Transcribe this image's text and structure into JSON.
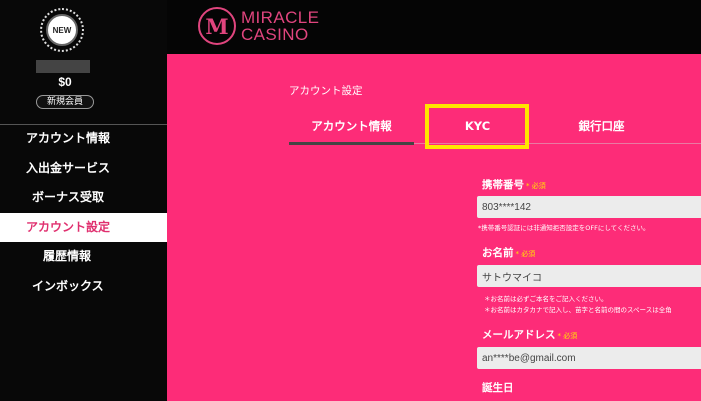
{
  "brand": {
    "line1": "MIRACLE",
    "line2": "CASINO",
    "emblem": "M"
  },
  "user": {
    "badge_label": "NEW",
    "balance": "$0",
    "member_tier": "新規会員"
  },
  "sidebar": {
    "items": [
      {
        "label": "アカウント情報"
      },
      {
        "label": "入出金サービス"
      },
      {
        "label": "ボーナス受取"
      },
      {
        "label": "アカウント設定"
      },
      {
        "label": "履歴情報"
      },
      {
        "label": "インボックス"
      }
    ],
    "active_index": 3
  },
  "main": {
    "heading": "アカウント設定",
    "tabs": [
      {
        "label": "アカウント情報"
      },
      {
        "label": "KYC"
      },
      {
        "label": "銀行口座"
      }
    ]
  },
  "form": {
    "required_tag": "* 必須",
    "phone": {
      "label": "携帯番号",
      "value": "803****142",
      "note": "*携帯番号認証には非通知拒否設定をOFFにしてください。"
    },
    "name": {
      "label": "お名前",
      "value": "サトウマイコ",
      "note1": "＊お名前は必ずご本名をご記入ください。",
      "note2": "＊お名前はカタカナで記入し、苗字と名前の間のスペースは全角"
    },
    "email": {
      "label": "メールアドレス",
      "value": "an****be@gmail.com"
    },
    "birthday": {
      "label": "誕生日"
    }
  },
  "colors": {
    "main_bg": "#fd2c78",
    "sidebar_bg": "#080808",
    "accent_pink": "#e0457e",
    "highlight_yellow": "#ffe500",
    "input_bg": "#ececec"
  }
}
